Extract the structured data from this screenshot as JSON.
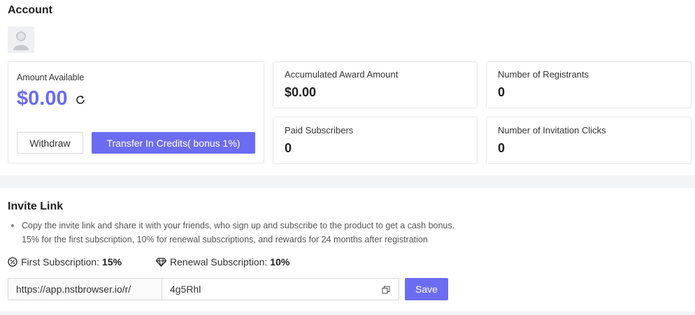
{
  "account": {
    "title": "Account",
    "amount_card": {
      "label": "Amount Available",
      "amount": "$0.00",
      "withdraw_label": "Withdraw",
      "transfer_label": "Transfer In Credits( bonus 1%)"
    },
    "stats": [
      {
        "label": "Accumulated Award Amount",
        "value": "$0.00"
      },
      {
        "label": "Number of Registrants",
        "value": "0"
      },
      {
        "label": "Paid Subscribers",
        "value": "0"
      },
      {
        "label": "Number of Invitation Clicks",
        "value": "0"
      }
    ]
  },
  "invite": {
    "title": "Invite Link",
    "bullets": [
      "Copy the invite link and share it with your friends, who sign up and subscribe to the product to get a cash bonus.",
      "15% for the first subscription, 10% for renewal subscriptions, and rewards for 24 months after registration"
    ],
    "first_subscription": {
      "label": "First Subscription:",
      "value": "15%"
    },
    "renewal_subscription": {
      "label": "Renewal Subscription:",
      "value": "10%"
    },
    "link_prefix": "https://app.nstbrowser.io/r/",
    "link_code": "4g5Rhl",
    "save_label": "Save"
  },
  "icons": {
    "avatar": "user-avatar-icon",
    "refresh": "refresh-icon",
    "percent": "percent-badge-icon",
    "diamond": "diamond-icon",
    "copy": "copy-icon"
  },
  "colors": {
    "accent": "#6c6cf2",
    "amount": "#6b6cf0",
    "divider": "#f3f4f6"
  }
}
